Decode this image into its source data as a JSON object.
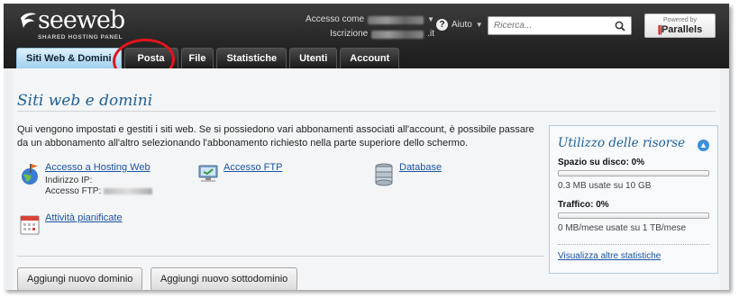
{
  "header": {
    "logo_text": "seeweb",
    "logo_subtitle": "SHARED HOSTING PANEL",
    "access_as_label": "Accesso come",
    "subscription_label": "Iscrizione",
    "subscription_suffix": ".it",
    "help_label": "Aiuto",
    "search_placeholder": "Ricerca...",
    "powered_by": "Powered by",
    "powered_brand": "Parallels"
  },
  "tabs": [
    {
      "label": "Siti Web & Domini",
      "active": true
    },
    {
      "label": "Posta"
    },
    {
      "label": "File"
    },
    {
      "label": "Statistiche"
    },
    {
      "label": "Utenti"
    },
    {
      "label": "Account"
    }
  ],
  "main": {
    "title": "Siti web e domini",
    "description": "Qui vengono impostati e gestiti i siti web. Se si possiedono vari abbonamenti associati all'account, è possibile passare da un abbonamento all'altro selezionando l'abbonamento richiesto nella parte superiore dello schermo.",
    "hosting_link": "Accesso a Hosting Web",
    "ip_label": "Indirizzo IP:",
    "ftp_access_label": "Accesso FTP:",
    "ftp_link": "Accesso FTP",
    "database_link": "Database",
    "scheduled_link": "Attività pianificate",
    "add_domain_button": "Aggiungi nuovo dominio",
    "add_subdomain_button": "Aggiungi nuovo sottodominio"
  },
  "resources": {
    "title": "Utilizzo delle risorse",
    "disk_label": "Spazio su disco: 0%",
    "disk_percent": 0,
    "disk_usage": "0.3 MB usate su 10 GB",
    "traffic_label": "Traffico: 0%",
    "traffic_percent": 0,
    "traffic_usage": "0 MB/mese usate su 1 TB/mese",
    "more_stats_link": "Visualizza altre statistiche"
  }
}
